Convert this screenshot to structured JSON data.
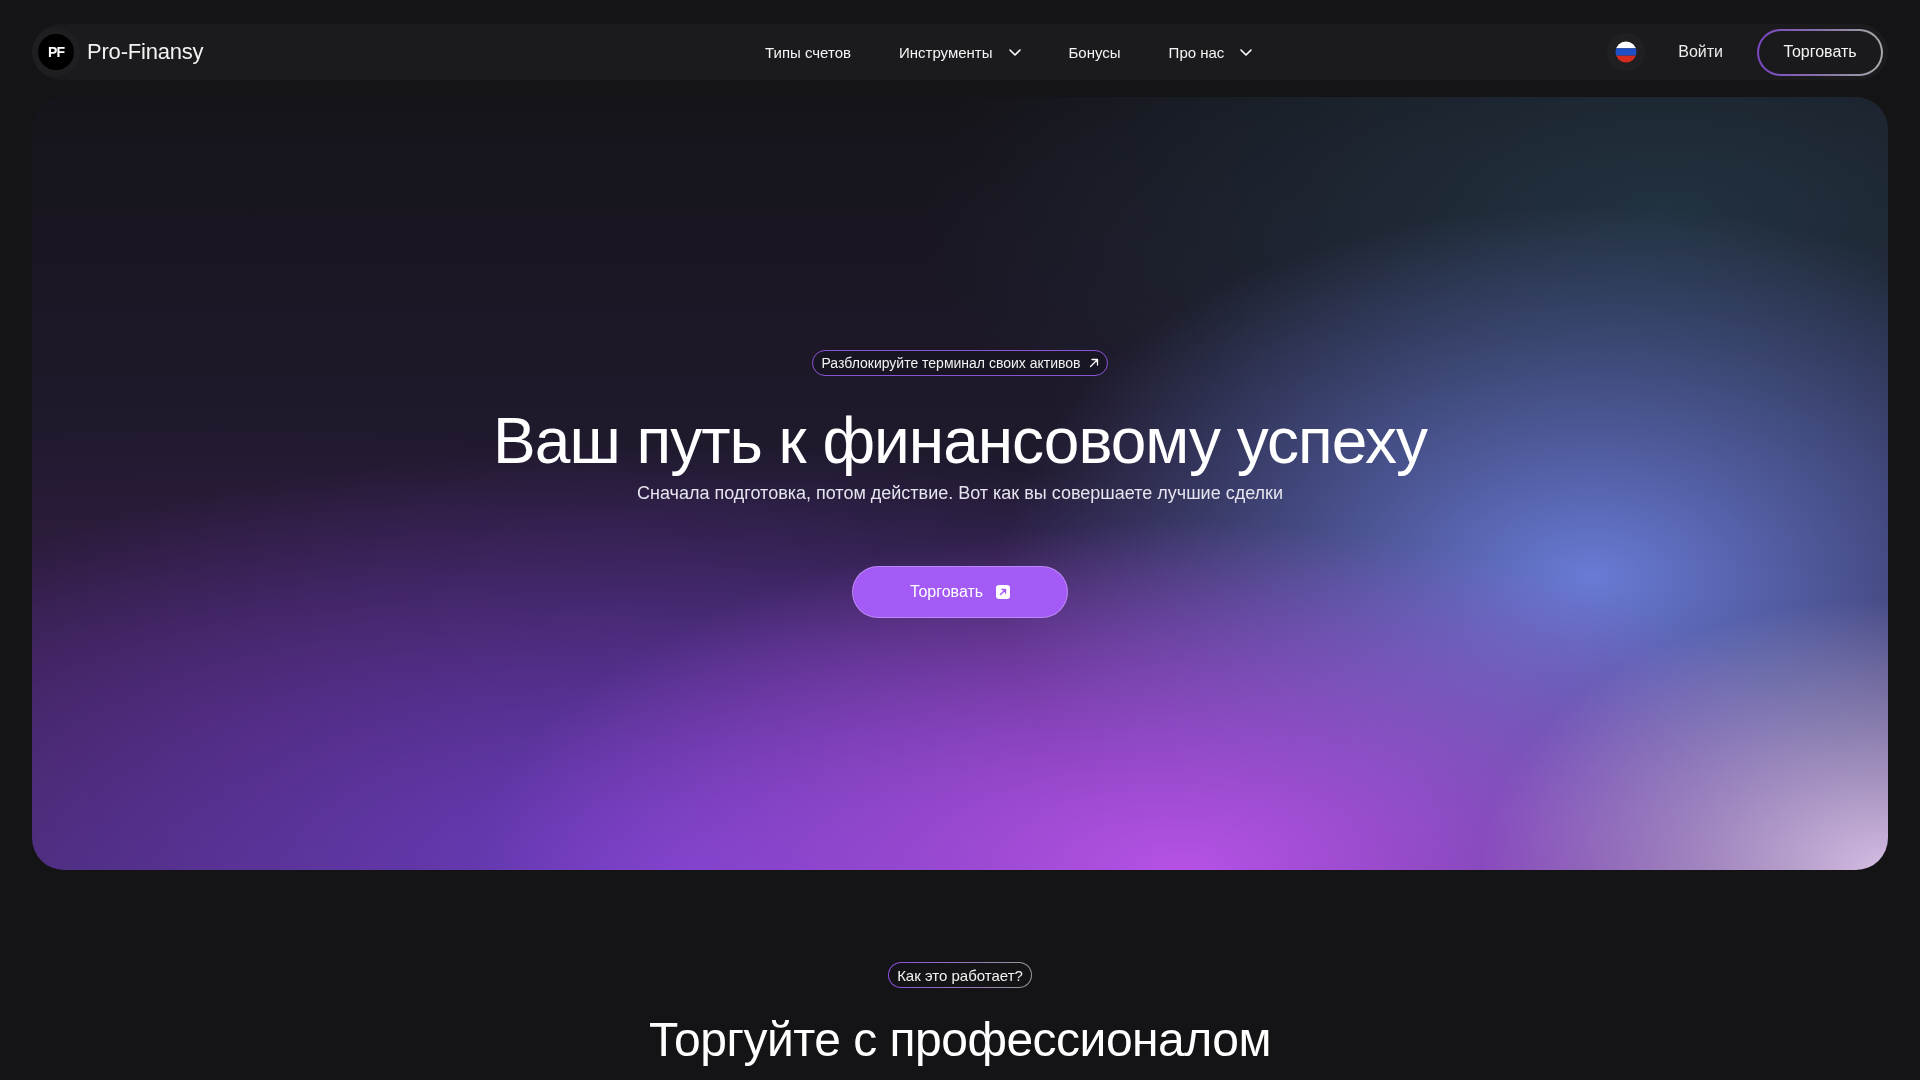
{
  "header": {
    "logo_mark": "PF",
    "brand": "Pro-Finansy",
    "nav": [
      {
        "label": "Типы счетов",
        "dropdown": false
      },
      {
        "label": "Инструменты",
        "dropdown": true
      },
      {
        "label": "Бонусы",
        "dropdown": false
      },
      {
        "label": "Про нас",
        "dropdown": true
      }
    ],
    "login": "Войти",
    "cta": "Торговать"
  },
  "hero": {
    "badge": "Разблокируйте терминал своих активов",
    "title": "Ваш путь к финансовому успеху",
    "subtitle": "Сначала подготовка, потом действие. Вот как вы совершаете лучшие сделки",
    "button": "Торговать"
  },
  "how_it_works": {
    "badge": "Как это работает?",
    "title": "Торгуйте с профессионалом"
  }
}
